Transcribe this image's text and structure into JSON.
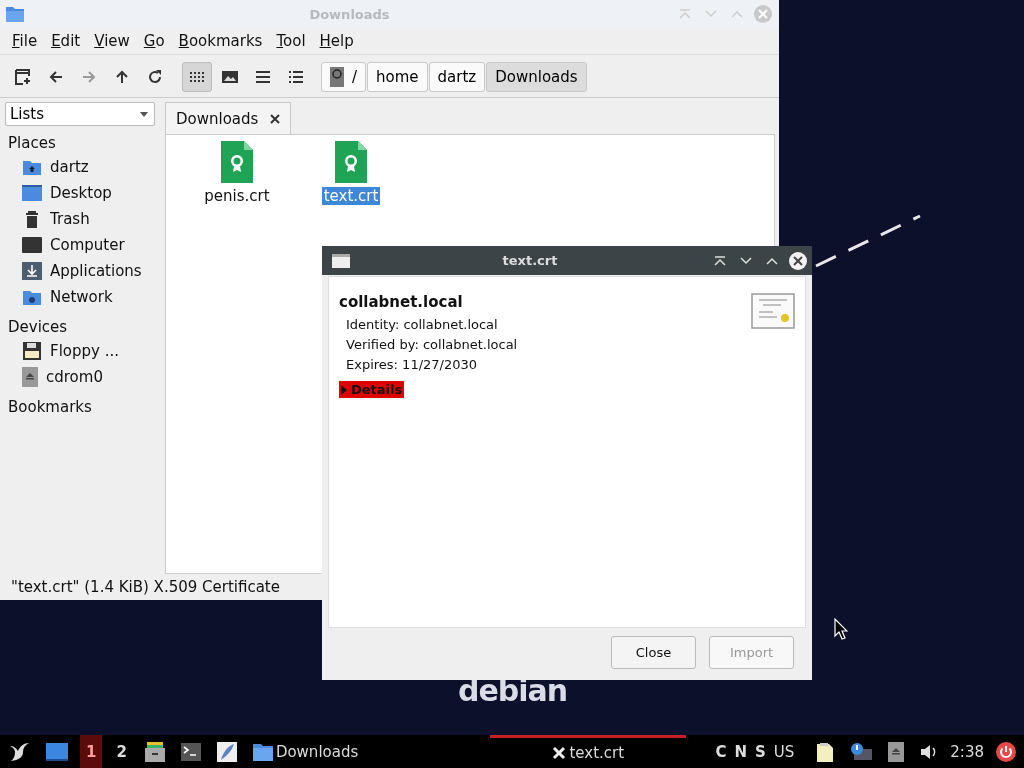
{
  "file_manager": {
    "title": "Downloads",
    "active": false,
    "menu": [
      "File",
      "Edit",
      "View",
      "Go",
      "Bookmarks",
      "Tool",
      "Help"
    ],
    "view_modes": [
      {
        "kind": "icons",
        "selected": true
      },
      {
        "kind": "thumbnails",
        "selected": false
      },
      {
        "kind": "compact",
        "selected": false
      },
      {
        "kind": "list",
        "selected": false
      }
    ],
    "path": [
      {
        "label": "/",
        "kind": "root",
        "selected": false
      },
      {
        "label": "home",
        "kind": "dir",
        "selected": false
      },
      {
        "label": "dartz",
        "kind": "dir",
        "selected": false
      },
      {
        "label": "Downloads",
        "kind": "dir",
        "selected": true
      }
    ],
    "side_mode": "Lists",
    "sections": [
      {
        "title": "Places",
        "items": [
          {
            "label": "dartz",
            "kind": "home"
          },
          {
            "label": "Desktop",
            "kind": "desktop"
          },
          {
            "label": "Trash",
            "kind": "trash"
          },
          {
            "label": "Computer",
            "kind": "computer"
          },
          {
            "label": "Applications",
            "kind": "apps"
          },
          {
            "label": "Network",
            "kind": "network"
          }
        ]
      },
      {
        "title": "Devices",
        "items": [
          {
            "label": "Floppy ...",
            "kind": "floppy"
          },
          {
            "label": "cdrom0",
            "kind": "cdrom"
          }
        ]
      },
      {
        "title": "Bookmarks"
      }
    ],
    "tabs": [
      {
        "label": "Downloads",
        "selected": true
      }
    ],
    "files": [
      {
        "name": "penis.crt",
        "selected": false
      },
      {
        "name": "text.crt",
        "selected": true
      }
    ],
    "status": "\"text.crt\" (1.4 KiB) X.509 Certificate"
  },
  "dialog": {
    "title": "text.crt",
    "heading": "collabnet.local",
    "lines": [
      "Identity: collabnet.local",
      "Verified by: collabnet.local",
      "Expires: 11/27/2030"
    ],
    "details": {
      "label": "Details",
      "expanded": false
    },
    "buttons": [
      {
        "label": "Close",
        "disabled": false
      },
      {
        "label": "Import",
        "disabled": true
      }
    ]
  },
  "desktop": {
    "logo": "debian"
  },
  "taskbar": {
    "workspaces": [
      {
        "label": "1",
        "selected": true
      },
      {
        "label": "2",
        "selected": false
      }
    ],
    "tasks": [
      {
        "label": "Downloads",
        "kind": "folder",
        "active": false
      },
      {
        "label": "text.crt",
        "kind": "dialog",
        "active": true
      }
    ],
    "indicators": [
      "C",
      "N",
      "S"
    ],
    "layout": "US",
    "clock": "2:38"
  }
}
